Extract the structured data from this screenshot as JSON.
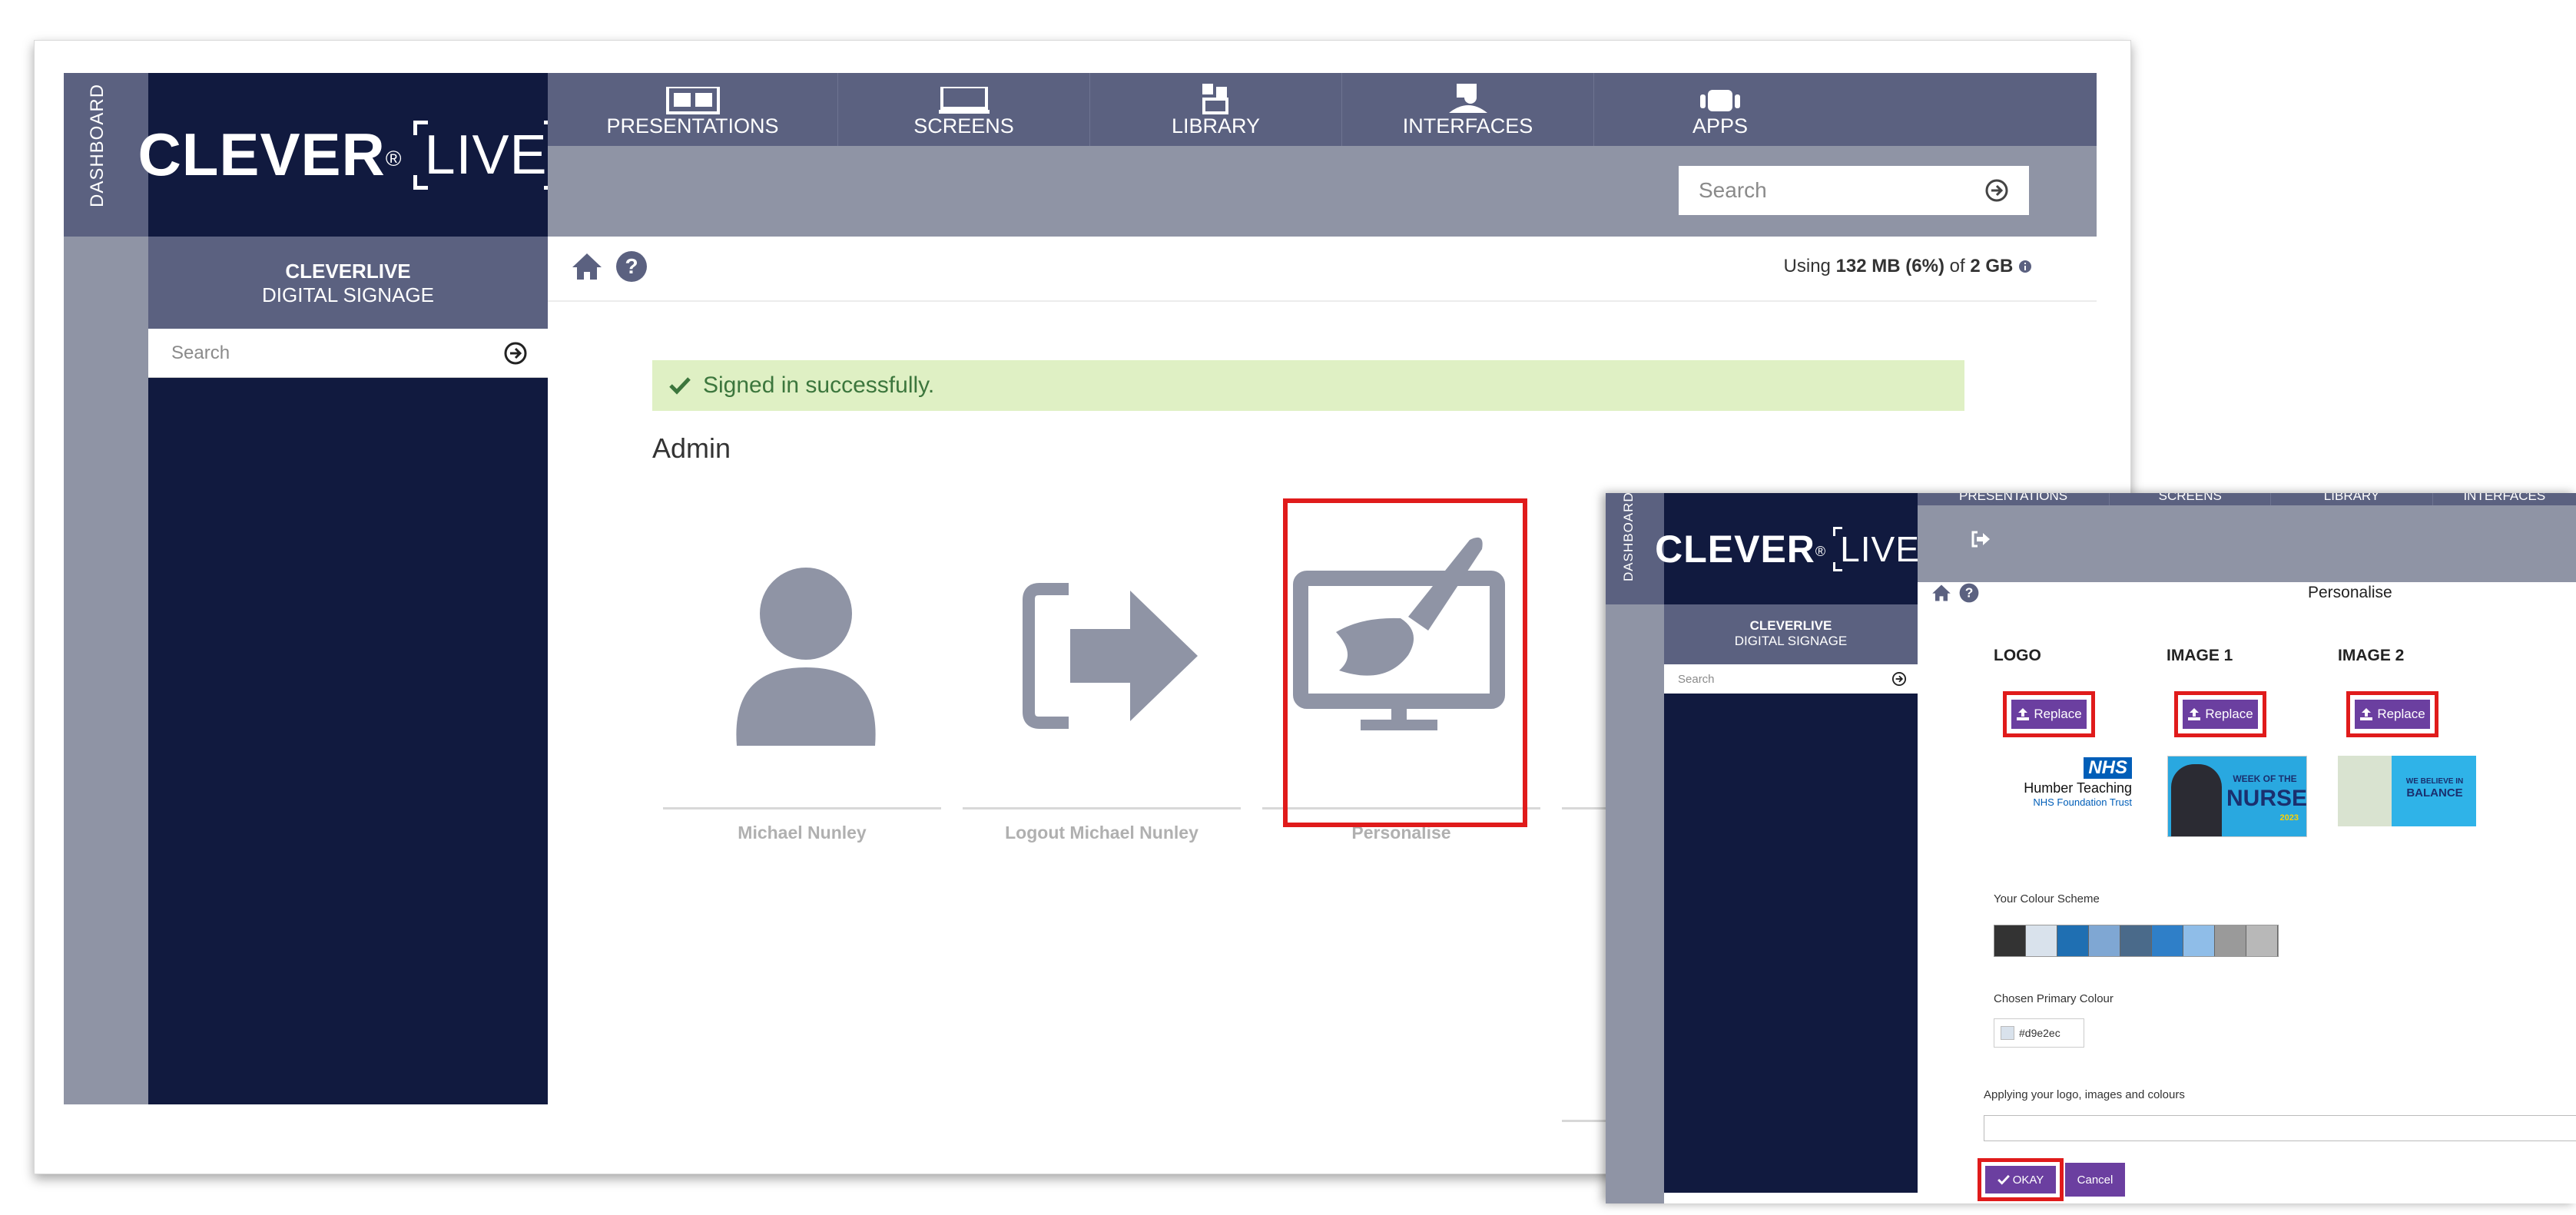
{
  "main": {
    "dashboard_label": "DASHBOARD",
    "brand": {
      "clever": "CLEVER",
      "reg": "®",
      "live": "LIVE"
    },
    "nav": [
      {
        "label": "PRESENTATIONS",
        "icon": "presentations-icon"
      },
      {
        "label": "SCREENS",
        "icon": "screens-icon"
      },
      {
        "label": "LIBRARY",
        "icon": "library-icon"
      },
      {
        "label": "INTERFACES",
        "icon": "interfaces-icon"
      },
      {
        "label": "APPS",
        "icon": "apps-icon"
      }
    ],
    "top_search_placeholder": "Search",
    "sidebar": {
      "title_line1": "CLEVERLIVE",
      "title_line2": "DIGITAL SIGNAGE",
      "search_placeholder": "Search"
    },
    "usage": {
      "prefix": "Using ",
      "used": "132 MB (6%)",
      "mid": " of ",
      "total": "2 GB"
    },
    "alert": "Signed in successfully.",
    "heading": "Admin",
    "tiles": [
      {
        "label": "Michael Nunley",
        "icon": "user-icon"
      },
      {
        "label": "Logout Michael Nunley",
        "icon": "logout-icon"
      },
      {
        "label": "Personalise",
        "icon": "personalise-icon"
      }
    ]
  },
  "overlay": {
    "dashboard_label": "DASHBOARD",
    "nav": [
      "PRESENTATIONS",
      "SCREENS",
      "LIBRARY",
      "INTERFACES"
    ],
    "sidebar": {
      "title_line1": "CLEVERLIVE",
      "title_line2": "DIGITAL SIGNAGE",
      "search_placeholder": "Search"
    },
    "page_title": "Personalise",
    "columns": [
      {
        "title": "LOGO",
        "button": "Replace"
      },
      {
        "title": "IMAGE 1",
        "button": "Replace"
      },
      {
        "title": "IMAGE 2",
        "button": "Replace"
      }
    ],
    "logo_image": {
      "nhs": "NHS",
      "line1": "Humber Teaching",
      "line2": "NHS Foundation Trust"
    },
    "image1_text": {
      "top": "WEEK OF THE",
      "big": "NURSE",
      "year": "2023"
    },
    "image2_text": {
      "top": "WE BELIEVE IN",
      "big": "BALANCE"
    },
    "colour_scheme_label": "Your Colour Scheme",
    "colour_scheme": [
      "#333333",
      "#d9e2ec",
      "#1f6fb2",
      "#7fa7d3",
      "#4a6a8a",
      "#2f7fc8",
      "#8fbde8",
      "#9a9a9a",
      "#b8b8b8"
    ],
    "primary_colour_label": "Chosen Primary Colour",
    "primary_colour_value": "#d9e2ec",
    "applying_label": "Applying your logo, images and colours",
    "okay_button": "OKAY",
    "cancel_button": "Cancel"
  }
}
